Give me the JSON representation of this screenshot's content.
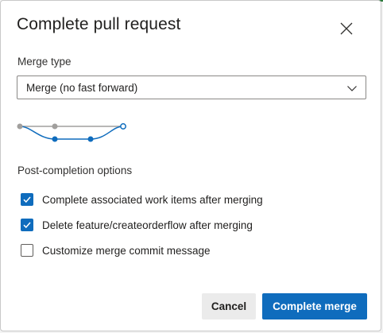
{
  "dialog": {
    "title": "Complete pull request",
    "close_icon": "close-icon"
  },
  "merge_type": {
    "label": "Merge type",
    "selected": "Merge (no fast forward)",
    "chevron_icon": "chevron-down-icon"
  },
  "graph": {
    "icon": "merge-graph-icon",
    "colors": {
      "main": "#a19f9d",
      "branch": "#0f6cbd"
    }
  },
  "post_completion": {
    "label": "Post-completion options",
    "options": [
      {
        "label": "Complete associated work items after merging",
        "checked": true
      },
      {
        "label": "Delete feature/createorderflow after merging",
        "checked": true
      },
      {
        "label": "Customize merge commit message",
        "checked": false
      }
    ]
  },
  "actions": {
    "cancel_label": "Cancel",
    "primary_label": "Complete merge"
  },
  "colors": {
    "accent": "#0f6cbd"
  }
}
